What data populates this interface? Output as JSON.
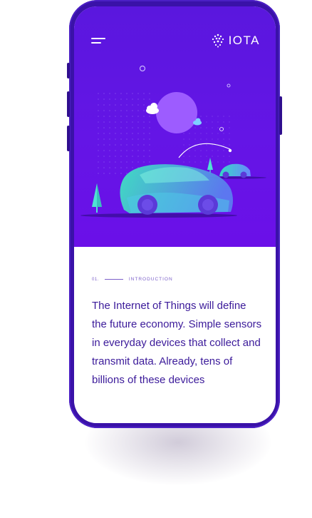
{
  "brand": {
    "logo_text": "IOTA",
    "logo_icon": "iota-dots-icon"
  },
  "header": {
    "menu_icon": "hamburger-menu-icon"
  },
  "section": {
    "number": "01.",
    "title": "INTRODUCTION",
    "body": "The Internet of Things will define the future economy. Simple sensors in everyday devices that collect and transmit data. Already, tens of billions of these devices"
  },
  "colors": {
    "phone_frame": "#3a12a8",
    "hero_bg": "#5a17de",
    "accent_text": "#3b1a9a",
    "car_gradient_start": "#3ee6c0",
    "car_gradient_end": "#5b7cf0"
  }
}
